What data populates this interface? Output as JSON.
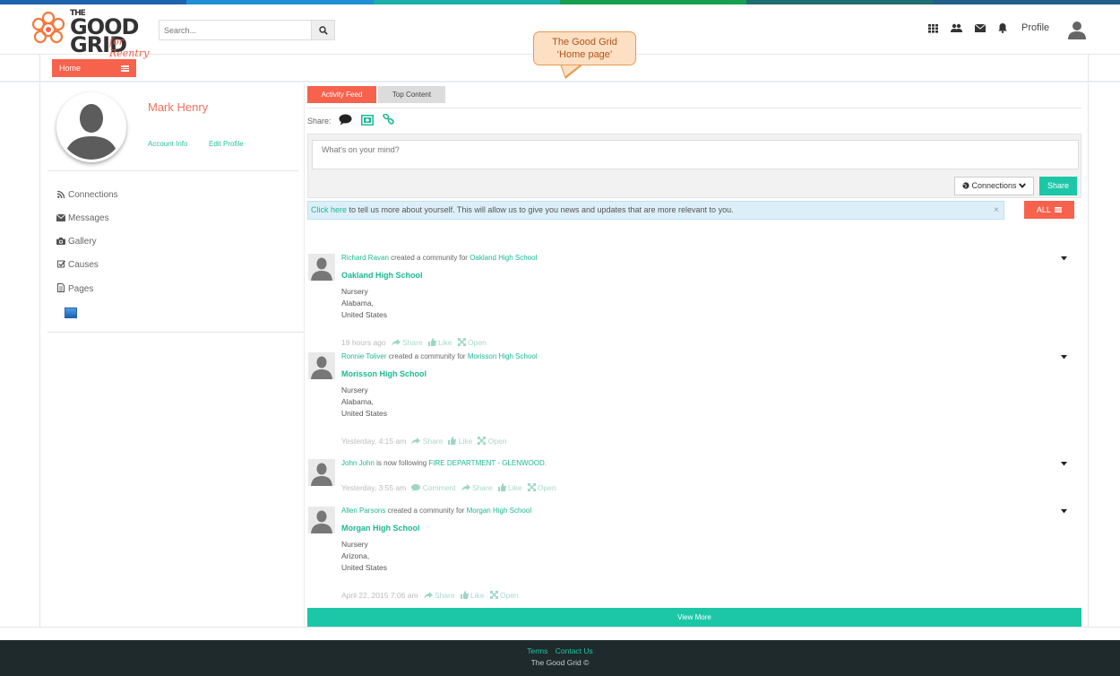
{
  "colors": {
    "stripe": [
      "#1f62b0",
      "#1e8fd4",
      "#1bb0a7",
      "#16a04f",
      "#1f6e72",
      "#1f5f8a"
    ],
    "accent": "#f7624d",
    "teal": "#1cc7a8"
  },
  "header": {
    "logo_top": "THE",
    "logo_good": "GOOD",
    "logo_grid": "GRID",
    "logo_tagline": "for Reentry",
    "search_placeholder": "Search...",
    "profile_label": "Profile"
  },
  "callout": {
    "line1": "The Good Grid",
    "line2": "‘Home page’"
  },
  "subnav": {
    "home_label": "Home"
  },
  "sidebar": {
    "user_name": "Mark Henry",
    "account_info": "Account Info",
    "edit_profile": "Edit Profile",
    "items": [
      {
        "label": "Connections",
        "icon": "rss-icon"
      },
      {
        "label": "Messages",
        "icon": "envelope-icon"
      },
      {
        "label": "Gallery",
        "icon": "camera-icon"
      },
      {
        "label": "Causes",
        "icon": "check-square-icon"
      },
      {
        "label": "Pages",
        "icon": "file-icon"
      }
    ]
  },
  "tabs": {
    "activity": "Activity Feed",
    "top": "Top Content"
  },
  "composer": {
    "share_label": "Share:",
    "placeholder": "What's on your mind?",
    "connections": "Connections",
    "share_button": "Share"
  },
  "alert": {
    "link": "Click here",
    "text": " to tell us more about yourself. This will allow us to give you news and updates that are more relevant to you.",
    "close": "×"
  },
  "filter": {
    "all": "ALL"
  },
  "feed": [
    {
      "user": "Richard Ravan",
      "action": " created a community for ",
      "target": "Oakland High School",
      "title": "Oakland High School",
      "lines": [
        "Nursery",
        "Alabama,",
        "United States"
      ],
      "time": "19 hours ago",
      "actions": [
        "Share",
        "Like",
        "Open"
      ]
    },
    {
      "user": "Ronnie Toliver",
      "action": " created a community for ",
      "target": "Morisson High School",
      "title": "Morisson High School",
      "lines": [
        "Nursery",
        "Alabama,",
        "United States"
      ],
      "time": "Yesterday, 4:15 am",
      "actions": [
        "Share",
        "Like",
        "Open"
      ]
    },
    {
      "user": "John John",
      "action": " is now following ",
      "target": "FIRE DEPARTMENT - GLENWOOD.",
      "title": "",
      "lines": [],
      "time": "Yesterday, 3:55 am",
      "actions": [
        "Comment",
        "Share",
        "Like",
        "Open"
      ]
    },
    {
      "user": "Allen Parsons",
      "action": " created a community for ",
      "target": "Morgan High School",
      "title": "Morgan High School",
      "lines": [
        "Nursery",
        "Arizona,",
        "United States"
      ],
      "time": "April 22, 2015 7:06 am",
      "actions": [
        "Share",
        "Like",
        "Open"
      ]
    }
  ],
  "view_more": "View More",
  "footer": {
    "terms": "Terms",
    "contact": "Contact Us",
    "copyright": "The Good Grid ©"
  }
}
